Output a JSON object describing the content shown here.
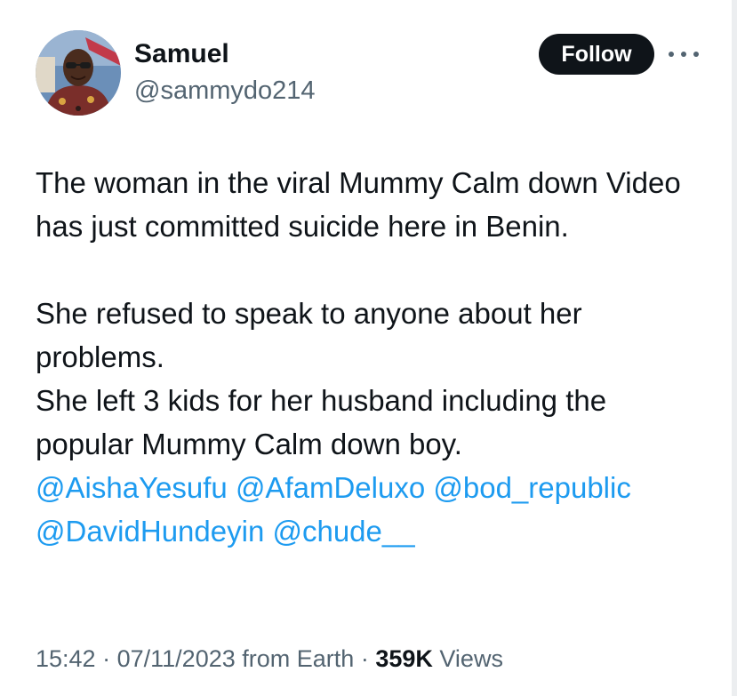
{
  "author": {
    "display_name": "Samuel",
    "handle": "@sammydo214",
    "avatar_icon": "profile-photo"
  },
  "actions": {
    "follow_label": "Follow",
    "more_icon": "more-horizontal-icon"
  },
  "tweet": {
    "paragraph1": "The woman in the viral Mummy Calm down Video has just committed suicide here in Benin.",
    "line2": "She refused to speak to anyone about her problems.",
    "line3": "She left 3 kids for her husband including the popular Mummy Calm down boy.",
    "mentions": [
      "@AishaYesufu",
      "@AfamDeluxo",
      "@bod_republic",
      "@DavidHundeyin",
      "@chude__"
    ]
  },
  "meta": {
    "time": "15:42",
    "separator": "·",
    "date": "07/11/2023",
    "source": "from Earth",
    "views_count": "359K",
    "views_label": "Views"
  },
  "colors": {
    "text": "#0f1419",
    "secondary": "#536471",
    "link": "#1d9bf0",
    "button": "#0f1419"
  }
}
